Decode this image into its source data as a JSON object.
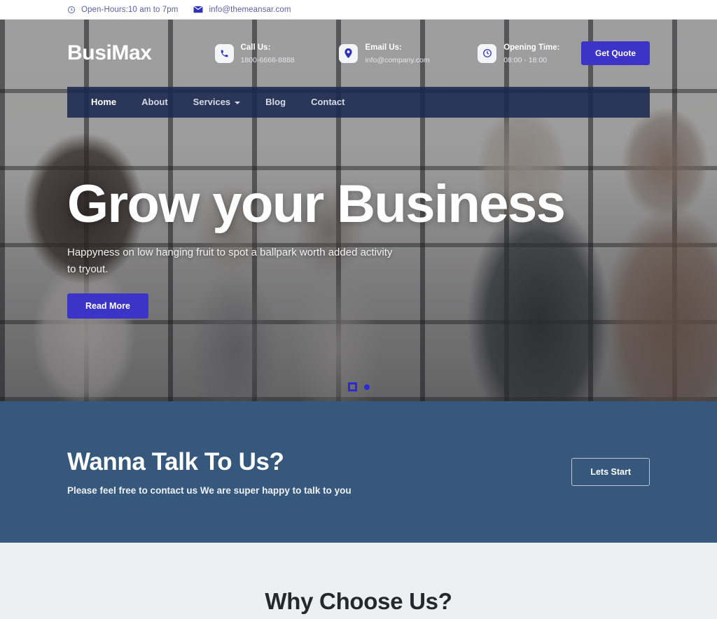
{
  "topbar": {
    "items": [
      {
        "icon": "clock-icon",
        "label": "Open-Hours:10 am to 7pm"
      },
      {
        "icon": "envelope-icon",
        "label": "info@themeansar.com"
      }
    ]
  },
  "header": {
    "logo": "BusiMax",
    "contacts": [
      {
        "icon": "phone-icon",
        "title": "Call Us:",
        "value": "1800-6666-8888"
      },
      {
        "icon": "map-pin-icon",
        "title": "Email Us:",
        "value": "info@company.com"
      },
      {
        "icon": "clock-icon",
        "title": "Opening Time:",
        "value": "08:00 - 18:00"
      }
    ],
    "quote_button": "Get Quote"
  },
  "nav": {
    "items": [
      {
        "label": "Home",
        "active": true,
        "dropdown": false
      },
      {
        "label": "About",
        "active": false,
        "dropdown": false
      },
      {
        "label": "Services",
        "active": false,
        "dropdown": true
      },
      {
        "label": "Blog",
        "active": false,
        "dropdown": false
      },
      {
        "label": "Contact",
        "active": false,
        "dropdown": false
      }
    ]
  },
  "hero": {
    "title": "Grow your Business",
    "subtitle": "Happyness on low hanging fruit to spot a ballpark worth added activity to tryout.",
    "button": "Read More",
    "slider": {
      "total": 2,
      "active_index": 0
    }
  },
  "cta": {
    "title": "Wanna Talk To Us?",
    "subtitle": "Please feel free to contact us We are super happy to talk to you",
    "button": "Lets Start"
  },
  "why": {
    "title": "Why Choose Us?"
  },
  "colors": {
    "accent_indigo": "#3b34c7",
    "nav_navy": "#1b294e",
    "cta_steel_blue": "#36587c",
    "section_light": "#edf0f3",
    "topbar_text": "#5b5fa8"
  }
}
